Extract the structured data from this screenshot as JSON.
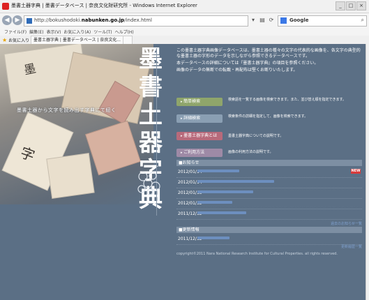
{
  "window": {
    "title": "墨書土器字典 | 墨書データベース | 奈良文化財研究所 - Windows Internet Explorer",
    "controls": [
      "_",
      "□",
      "×"
    ]
  },
  "address": {
    "url_prefix": "http://bokushodoki.",
    "url_domain": "nabunken.go.jp",
    "url_suffix": "/index.html",
    "search_engine": "Google"
  },
  "menu": [
    "ファイル(F)",
    "編集(E)",
    "表示(V)",
    "お気に入り(A)",
    "ツール(T)",
    "ヘルプ(H)"
  ],
  "favorites": {
    "label": "お気に入り"
  },
  "tabs": [
    {
      "label": "墨書土器字典 | 墨書データベース | 奈良文化..."
    }
  ],
  "page": {
    "collage_caption": "墨書土器から文字を読み出す字典にて紐く",
    "subtitle_vertical": "墨書土器・字典",
    "title_vertical": "墨書土器字典",
    "intro": [
      "この墨書土器字典画像データベースは、墨書土器の種々の文字の代表的な画像を、各文字の典型的な墨書土器の字形のデータを示しながら参照できるデータベースです。",
      "本データベースの詳細については『墨書土器字典』の項目を参照ください。",
      "画像のデータの無断での転載・再配布は堅くお断りいたします。"
    ],
    "menu_buttons": [
      {
        "label": "簡単検索",
        "desc": "検索語を一覧する画像を検索できます。また、並び替え順を指定できます。"
      },
      {
        "label": "詳細検索",
        "desc": "検索条件の詳細を指定して、画像を検索できます。"
      },
      {
        "label": "墨書土器字典とは",
        "desc": "墨書土器字典についての説明です。"
      },
      {
        "label": "ご利用方法",
        "desc": "画像の利用方法の説明です。"
      }
    ],
    "news_header": "■お知らせ",
    "news": [
      {
        "date": "2012/01/14",
        "new": "NEW"
      },
      {
        "date": "2012/01/14",
        "new": ""
      },
      {
        "date": "2012/01/13",
        "new": ""
      },
      {
        "date": "2012/01/12",
        "new": ""
      },
      {
        "date": "2011/12/12",
        "new": ""
      }
    ],
    "news_more": "過去のお知らせ一覧",
    "update_header": "■更新情報",
    "updates": [
      {
        "date": "2011/12/12"
      }
    ],
    "update_more": "更新履歴一覧",
    "footer": "copyright©2011 Nara National Research Institute for Cultural Properties. all rights reserved."
  }
}
